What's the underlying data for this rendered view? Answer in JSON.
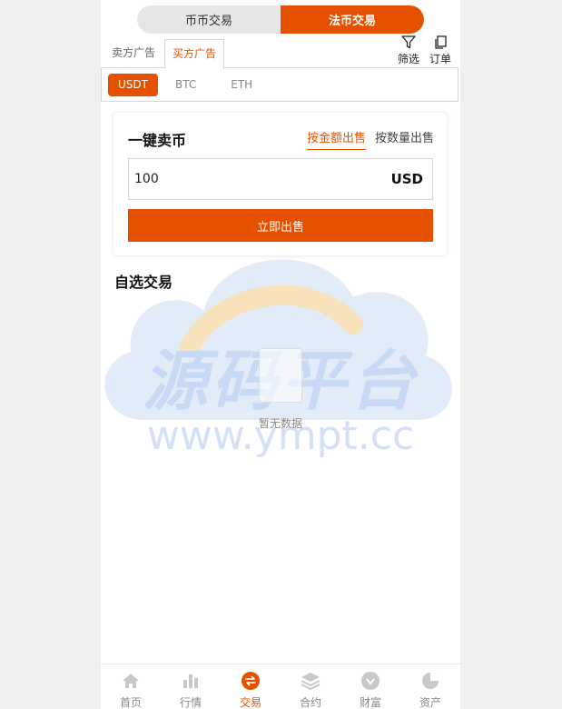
{
  "top_toggle": {
    "spot_label": "币币交易",
    "fiat_label": "法币交易"
  },
  "ad_tabs": {
    "sell_ads": "卖方广告",
    "buy_ads": "买方广告"
  },
  "tools": {
    "filter_label": "筛选",
    "orders_label": "订单"
  },
  "coins": [
    "USDT",
    "BTC",
    "ETH"
  ],
  "quick_sell": {
    "title": "一键卖币",
    "by_amount": "按金额出售",
    "by_quantity": "按数量出售",
    "amount_value": "100",
    "currency": "USD",
    "button": "立即出售"
  },
  "section": {
    "title": "自选交易"
  },
  "empty": {
    "text": "暂无数据"
  },
  "watermark": {
    "title": "源码平台",
    "url": "www.ympt.cc"
  },
  "bottom_nav": [
    "首页",
    "行情",
    "交易",
    "合约",
    "财富",
    "资产"
  ],
  "colors": {
    "accent": "#e65100",
    "nav_icon": "#c8c8c8"
  }
}
